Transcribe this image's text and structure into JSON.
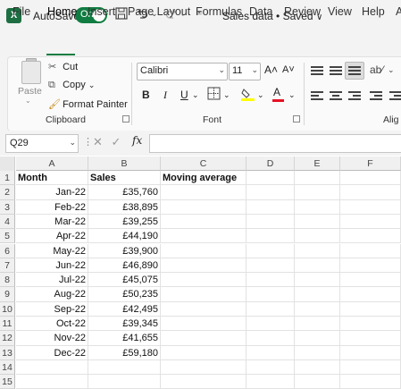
{
  "titlebar": {
    "app_icon_letter": "X",
    "autosave_label": "AutoSave",
    "toggle_state": "On",
    "doc_title": "Sales data • Saved",
    "doc_title_chevron": "∨",
    "icons": [
      "save-icon",
      "undo-icon",
      "redo-icon",
      "customize-toolbar-icon"
    ]
  },
  "tabs": [
    "File",
    "Home",
    "Insert",
    "Page Layout",
    "Formulas",
    "Data",
    "Review",
    "View",
    "Help",
    "A"
  ],
  "active_tab": "Home",
  "clipboard": {
    "paste_label": "Paste",
    "cut_label": "Cut",
    "copy_label": "Copy",
    "format_painter_label": "Format Painter",
    "group_label": "Clipboard"
  },
  "font": {
    "name": "Calibri",
    "size": "11",
    "group_label": "Font",
    "bold": "B",
    "italic": "I",
    "underline": "U",
    "grow": "A˄",
    "shrink": "A˅",
    "font_color_letter": "A",
    "font_color": "#e81123",
    "highlight_color": "#ffff00"
  },
  "alignment": {
    "group_label": "Alig"
  },
  "formula_bar": {
    "cell_ref": "Q29",
    "dots": "⋮",
    "cancel": "✕",
    "enter": "✓",
    "fx": "fx",
    "formula": ""
  },
  "columns": [
    "A",
    "B",
    "C",
    "D",
    "E",
    "F"
  ],
  "rows": [
    "1",
    "2",
    "3",
    "4",
    "5",
    "6",
    "7",
    "8",
    "9",
    "10",
    "11",
    "12",
    "13",
    "14",
    "15"
  ],
  "sheet": {
    "headers": [
      "Month",
      "Sales",
      "Moving average"
    ],
    "data": [
      [
        "Jan-22",
        "£35,760"
      ],
      [
        "Feb-22",
        "£38,895"
      ],
      [
        "Mar-22",
        "£39,255"
      ],
      [
        "Apr-22",
        "£44,190"
      ],
      [
        "May-22",
        "£39,900"
      ],
      [
        "Jun-22",
        "£46,890"
      ],
      [
        "Jul-22",
        "£45,075"
      ],
      [
        "Aug-22",
        "£50,235"
      ],
      [
        "Sep-22",
        "£42,495"
      ],
      [
        "Oct-22",
        "£39,345"
      ],
      [
        "Nov-22",
        "£41,655"
      ],
      [
        "Dec-22",
        "£59,180"
      ]
    ]
  },
  "colors": {
    "accent": "#107c41",
    "excel_green": "#1d6f42"
  }
}
